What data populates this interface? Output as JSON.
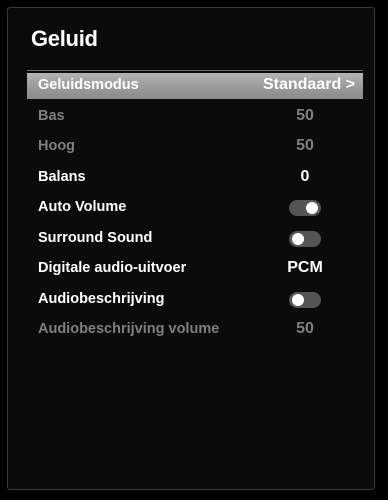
{
  "menu": {
    "title": "Geluid",
    "items": [
      {
        "label": "Geluidsmodus",
        "value": "Standaard >"
      },
      {
        "label": "Bas",
        "value": "50"
      },
      {
        "label": "Hoog",
        "value": "50"
      },
      {
        "label": "Balans",
        "value": "0"
      },
      {
        "label": "Auto Volume",
        "toggle": "on"
      },
      {
        "label": "Surround Sound",
        "toggle": "off"
      },
      {
        "label": "Digitale audio-uitvoer",
        "value": "PCM"
      },
      {
        "label": "Audiobeschrijving",
        "toggle": "off"
      },
      {
        "label": "Audiobeschrijving volume",
        "value": "50"
      }
    ]
  },
  "colors": {
    "background": "#000000",
    "panel": "#0b0b0b",
    "highlight": "#a6a6a6",
    "text_active": "#ffffff",
    "text_disabled": "#7f7f7f",
    "toggle_track": "#555555"
  }
}
